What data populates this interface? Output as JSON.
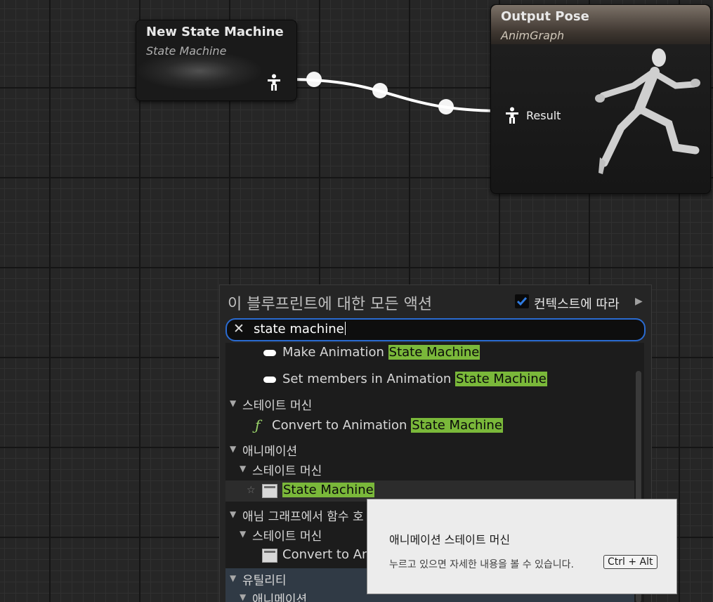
{
  "graph": {
    "state_machine_node": {
      "title": "New State Machine",
      "subtitle": "State Machine",
      "pin_icon": "pose-pin-icon"
    },
    "output_pose_node": {
      "title": "Output Pose",
      "subtitle": "AnimGraph",
      "pin_label": "Result",
      "pin_icon": "pose-pin-icon"
    }
  },
  "action_menu": {
    "title": "이 블루프린트에 대한 모든 액션",
    "context_sensitive_label": "컨텍스트에 따라",
    "context_sensitive_checked": true,
    "search_value": "state machine",
    "items": [
      {
        "prefix": "Make Animation ",
        "match": "State Machine"
      },
      {
        "prefix": "Set members in Animation ",
        "match": "State Machine"
      },
      {
        "category": "스테이트 머신"
      },
      {
        "prefix": "Convert to Animation ",
        "match": "State Machine"
      },
      {
        "category": "애니메이션"
      },
      {
        "subcategory": "스테이트 머신"
      },
      {
        "prefix": "",
        "match": "State Machine"
      },
      {
        "category": "애님 그래프에서 함수 호"
      },
      {
        "subcategory": "스테이트 머신"
      },
      {
        "prefix": "Convert to An"
      },
      {
        "category": "유틸리티"
      },
      {
        "subcategory": "애니메이션"
      }
    ]
  },
  "tooltip": {
    "title": "애니메이션 스테이트 머신",
    "hint": "누르고 있으면 자세한 내용을 볼 수 있습니다.",
    "shortcut": "Ctrl + Alt"
  },
  "colors": {
    "search_highlight": "#7ab83a",
    "search_border": "#2a6bd1",
    "function_icon": "#9ad36a"
  }
}
